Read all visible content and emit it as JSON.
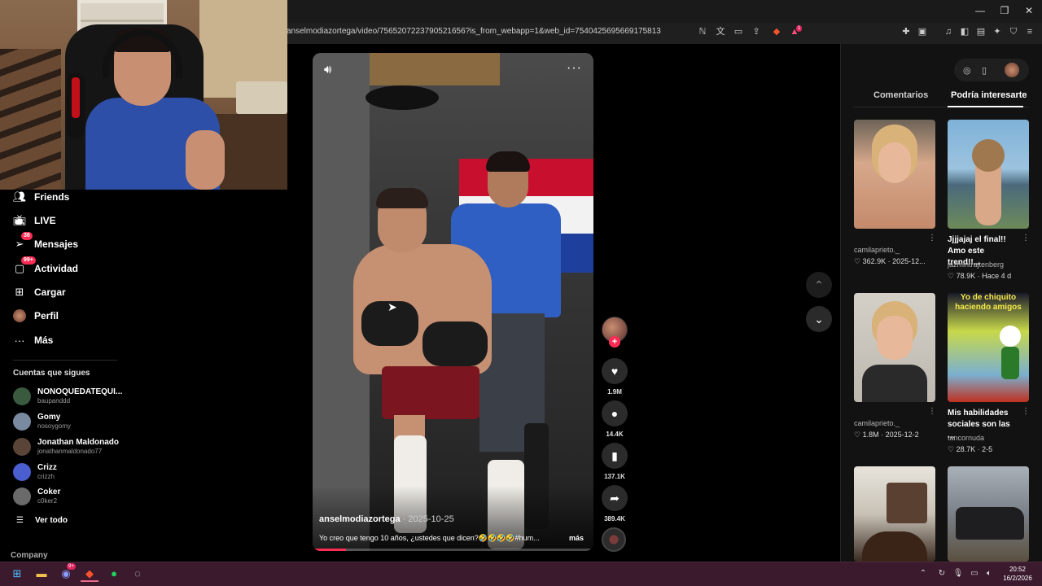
{
  "browser": {
    "url": "anselmodiazortega/video/7565207223790521656?is_from_webapp=1&web_id=7540425695669175813",
    "window_controls": [
      "—",
      "❐",
      "✕"
    ],
    "brave_badge": "1"
  },
  "sidebar": {
    "items": [
      {
        "label": "Friends",
        "icon": "friends-icon"
      },
      {
        "label": "LIVE",
        "icon": "live-tv-icon"
      },
      {
        "label": "Mensajes",
        "icon": "messages-icon",
        "badge": "36"
      },
      {
        "label": "Actividad",
        "icon": "activity-icon",
        "badge": "99+"
      },
      {
        "label": "Cargar",
        "icon": "upload-icon"
      },
      {
        "label": "Perfil",
        "icon": "profile-avatar"
      },
      {
        "label": "Más",
        "icon": "more-dots-icon"
      }
    ],
    "following_title": "Cuentas que sigues",
    "following": [
      {
        "name": "NONOQUEDATEQUI...",
        "handle": "baupanddd",
        "color": "#3a5a40"
      },
      {
        "name": "Gomy",
        "handle": "nosoygomy",
        "color": "#7a8aa0"
      },
      {
        "name": "Jonathan Maldonado",
        "handle": "jonathanmaldonado77",
        "color": "#5a4438"
      },
      {
        "name": "Crizz",
        "handle": "crizzh",
        "color": "#4a5ed0"
      },
      {
        "name": "Coker",
        "handle": "c0ker2",
        "color": "#6a6a6a"
      }
    ],
    "see_all": "Ver todo",
    "company": "Company"
  },
  "video": {
    "author": "anselmodiazortega",
    "date": "· 2025-10-25",
    "caption": "Yo creo que tengo 10 años, ¿ustedes que dicen?🤣🤣🤣🤣#hum...",
    "caption_more": "más",
    "progress": 0.12
  },
  "actions": {
    "likes": "1.9M",
    "comments": "14.4K",
    "saves": "137.1K",
    "shares": "389.4K"
  },
  "right_panel": {
    "tabs": [
      "Comentarios",
      "Podría interesarte"
    ],
    "active_tab": "Podría interesarte",
    "cards": [
      {
        "title": "",
        "user": "camilaprieto._",
        "likes": "362.9K",
        "time": "2025-12..."
      },
      {
        "title": "Jjjjajaj el final!! Amo este trend!!...",
        "user": "jazmintrajtenberg",
        "likes": "78.9K",
        "time": "Hace 4 d"
      },
      {
        "title": "",
        "user": "camilaprieto._",
        "likes": "1.8M",
        "time": "2025-12-2"
      },
      {
        "title": "Mis habilidades sociales son las ...",
        "user": "tancornuda",
        "likes": "28.7K",
        "time": "2-5",
        "overlay": "Yo de chiquito haciendo amigos"
      },
      {
        "title": "",
        "user": "",
        "likes": "",
        "time": ""
      },
      {
        "title": "",
        "user": "",
        "likes": "",
        "time": ""
      }
    ]
  },
  "taskbar": {
    "time": "20:52",
    "date": "16/2/2026",
    "discord_badge": "9+"
  }
}
